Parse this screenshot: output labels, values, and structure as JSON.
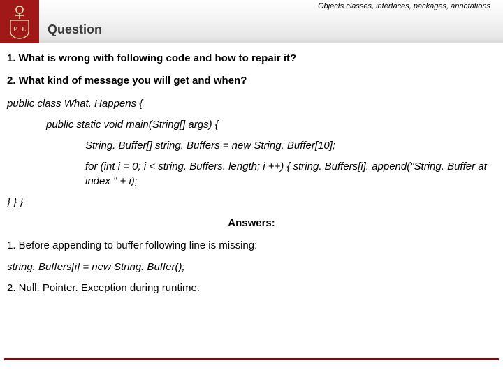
{
  "header": {
    "title": "Question",
    "topic": "Objects classes, interfaces, packages, annotations",
    "logo_letters": {
      "left": "P",
      "right": "Ł"
    }
  },
  "questions": {
    "q1": "1. What is wrong with following code and how to repair it?",
    "q2": "2. What kind of message you will get and when?"
  },
  "code": {
    "l1": "public class What. Happens {",
    "l2": "public static void main(String[] args) {",
    "l3": "String. Buffer[] string. Buffers = new String. Buffer[10];",
    "l4": "for (int i = 0; i < string. Buffers. length; i ++) { string. Buffers[i]. append(\"String. Buffer at index \" + i);",
    "close": "} } }"
  },
  "answers": {
    "heading": "Answers:",
    "a1": "1. Before appending to buffer following line is missing:",
    "a1_code": "string. Buffers[i] = new String. Buffer();",
    "a2": "2. Null. Pointer. Exception during runtime."
  }
}
